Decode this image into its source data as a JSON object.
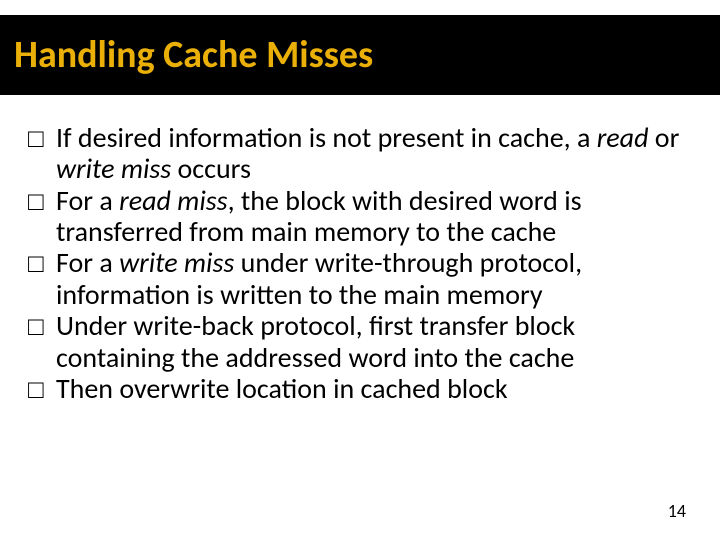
{
  "slide": {
    "title": "Handling Cache Misses",
    "title_color": "#eab007",
    "bullet_marker": "□",
    "bullets": [
      {
        "pre": "If desired information is not present in cache, a ",
        "em1": "read",
        "mid": " or ",
        "em2": "write miss",
        "post": " occurs"
      },
      {
        "pre": "For a ",
        "em1": "read miss",
        "mid": "",
        "em2": "",
        "post": ", the block with desired word is transferred from main memory to the cache"
      },
      {
        "pre": "For a ",
        "em1": "write miss",
        "mid": "",
        "em2": "",
        "post": " under write-through protocol, information is written to the main memory"
      },
      {
        "pre": "Under write-back protocol, first transfer block containing the addressed word into the cache",
        "em1": "",
        "mid": "",
        "em2": "",
        "post": ""
      },
      {
        "pre": "Then overwrite location in cached block",
        "em1": "",
        "mid": "",
        "em2": "",
        "post": ""
      }
    ],
    "page_number": "14"
  }
}
